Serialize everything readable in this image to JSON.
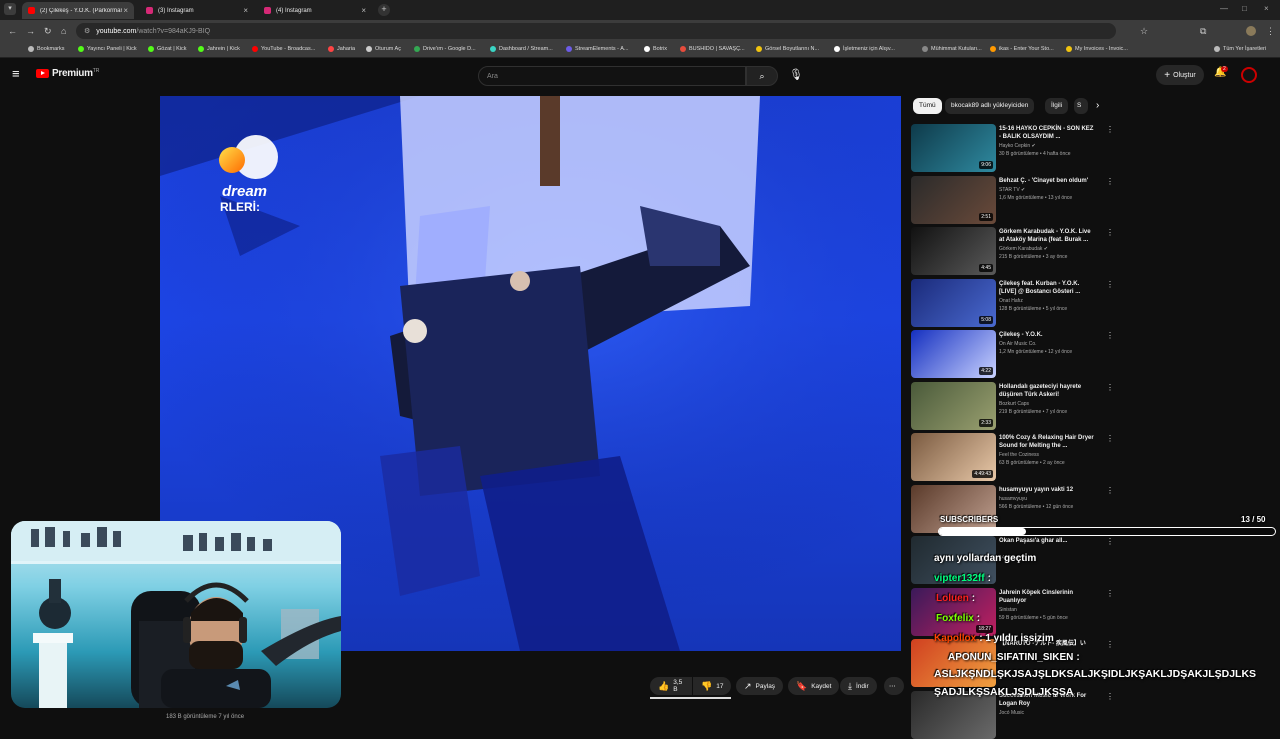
{
  "tabs": [
    {
      "label": "(2) Çilekeş - Y.O.K. (Parkorman)",
      "color": "#ff0000",
      "active": true
    },
    {
      "label": "(3) Instagram",
      "color": "#d62976",
      "active": false
    },
    {
      "label": "(4) Instagram",
      "color": "#d62976",
      "active": false
    }
  ],
  "address": {
    "domain": "youtube.com",
    "path": "/watch?v=984aKJ9-BIQ"
  },
  "bookmarks": [
    {
      "label": "Bookmarks",
      "color": "#bbbbbb"
    },
    {
      "label": "Yayıncı Paneli | Kick",
      "color": "#53fc18"
    },
    {
      "label": "Gözat | Kick",
      "color": "#53fc18"
    },
    {
      "label": "Jahrein | Kick",
      "color": "#53fc18"
    },
    {
      "label": "YouTube - Broadcas...",
      "color": "#ff0000"
    },
    {
      "label": "Jaharia",
      "color": "#ff4444"
    },
    {
      "label": "Oturum Aç",
      "color": "#cccccc"
    },
    {
      "label": "Drive'ım - Google D...",
      "color": "#34a853"
    },
    {
      "label": "Dashboard / Stream...",
      "color": "#3ad4c4"
    },
    {
      "label": "StreamElements - A...",
      "color": "#6c5ce7"
    },
    {
      "label": "Botrix",
      "color": "#ffffff"
    },
    {
      "label": "BUSHIDO | SAVAŞÇ...",
      "color": "#e74c3c"
    },
    {
      "label": "Görsel Boyutlarını N...",
      "color": "#f1c40f"
    },
    {
      "label": "İşletmeniz için Alışv...",
      "color": "#ffffff"
    },
    {
      "label": "Mühimmat Kutuları...",
      "color": "#888888"
    },
    {
      "label": "ikas - Enter Your Sto...",
      "color": "#ff9900"
    },
    {
      "label": "My Invoices - Invoic...",
      "color": "#f1c40f"
    },
    {
      "label": "Tüm Yer İşaretleri",
      "color": "#bbbbbb"
    }
  ],
  "header": {
    "logo": "Premium",
    "logo_sup": "TR",
    "search_placeholder": "Ara",
    "create_label": "Oluştur",
    "notif_count": "2"
  },
  "video": {
    "channel_logo": "dream",
    "logo_subtext": "RLERİ:"
  },
  "chips": [
    {
      "label": "Tümü",
      "selected": true
    },
    {
      "label": "bkocak89 adlı yükleyiciden",
      "selected": false
    },
    {
      "label": "İlgili",
      "selected": false
    },
    {
      "label": "S",
      "selected": false
    }
  ],
  "recommendations": [
    {
      "title": "15-16 HAYKO CEPKİN - SON KEZ - BALIK OLSAYDIM ...",
      "channel": "Hayko Cepkin ✔",
      "meta": "30 B görüntüleme • 4 hafta önce",
      "duration": "9:06",
      "c1": "#0e3a4a",
      "c2": "#2f8aa0"
    },
    {
      "title": "Behzat Ç. - 'Cinayet ben oldum'",
      "channel": "STAR TV ✔",
      "meta": "1,6 Mn görüntüleme • 13 yıl önce",
      "duration": "2:51",
      "c1": "#2a2a2a",
      "c2": "#6a4a3a"
    },
    {
      "title": "Görkem Karabudak - Y.O.K. Live at Ataköy Marina (feat. Burak ...",
      "channel": "Görkem Karabudak ✔",
      "meta": "215 B görüntüleme • 3 ay önce",
      "duration": "4:45",
      "c1": "#111111",
      "c2": "#5a5a5a"
    },
    {
      "title": "Çilekeş feat. Kurban - Y.O.K. [LIVE] @ Bostancı Gösteri ...",
      "channel": "Onat Hafız",
      "meta": "128 B görüntüleme • 5 yıl önce",
      "duration": "5:08",
      "c1": "#1a2a7a",
      "c2": "#4a6ad0"
    },
    {
      "title": "Çilekeş - Y.O.K.",
      "channel": "On Air Music Co.",
      "meta": "1,2 Mn görüntüleme • 12 yıl önce",
      "duration": "4:22",
      "c1": "#1530c0",
      "c2": "#c9d2ff"
    },
    {
      "title": "Hollandalı gazeteciyi hayrete düşüren Türk Askeri!",
      "channel": "Bozkurt Caps",
      "meta": "219 B görüntüleme • 7 yıl önce",
      "duration": "2:33",
      "c1": "#4a5a3a",
      "c2": "#9aa070"
    },
    {
      "title": "100% Cozy & Relaxing Hair Dryer Sound for Melting the ...",
      "channel": "Feel the Coziness",
      "meta": "63 B görüntüleme • 2 ay önce",
      "duration": "4:49:43",
      "c1": "#7a5a40",
      "c2": "#e8c8a8"
    },
    {
      "title": "husamyuyu yayın vakti 12",
      "channel": "husamvyuyu",
      "meta": "566 B görüntüleme • 12 gün önce",
      "duration": "",
      "c1": "#5a3a2a",
      "c2": "#c0a090"
    },
    {
      "title": "Okan Paşası'a ghar all...",
      "channel": "",
      "meta": "14 yıl önce",
      "duration": "",
      "c1": "#202a30",
      "c2": "#405060"
    },
    {
      "title": "Jahrein Köpek Cinslerinin Puanlıyor",
      "channel": "Sinistan",
      "meta": "59 B görüntüleme • 5 gün önce",
      "duration": "18:27",
      "c1": "#3a1a5a",
      "c2": "#c02060"
    },
    {
      "title": "【NARUTO -ナルト- 疾風伝】い",
      "channel": "",
      "meta": "",
      "duration": "",
      "c1": "#d04020",
      "c2": "#f0a040"
    },
    {
      "title": "Succession Music to Work For Logan Roy",
      "channel": "Jocó Music",
      "meta": "",
      "duration": "",
      "c1": "#2a2a2a",
      "c2": "#6a6a6a"
    }
  ],
  "actions": {
    "like": "3,5 B",
    "dislike": "17",
    "share": "Paylaş",
    "save": "Kaydet",
    "download": "İndir"
  },
  "below_video": "183 B görüntüleme  7 yıl önce",
  "overlay": {
    "subs_label": "SUBSCRIBERS",
    "subs_count": "13 / 50",
    "subs_fraction": 0.26,
    "messages": [
      {
        "user": "",
        "text": "aynı yollardan geçtim",
        "color": "#ffffff"
      },
      {
        "user": "vipter132ff",
        "text": ":",
        "color": "#00ff7f"
      },
      {
        "user": "Loluen",
        "text": ":",
        "color": "#ff2020"
      },
      {
        "user": "Foxfelix",
        "text": ":",
        "color": "#7cff00"
      },
      {
        "user": "Kapollox",
        "text": ": 1 yıldır işsizim",
        "color": "#ff4500"
      },
      {
        "user": "APONUN_SIFATINI_SIKEN",
        "text": ":",
        "color": "#ffffff"
      },
      {
        "user": "",
        "text": "ASLJKŞNDLŞKJSAJŞLDKSALJKŞIDLJKŞAKLJDŞAKJLŞDJLKS",
        "color": "#ffffff"
      },
      {
        "user": "",
        "text": "ŞADJLKŞSAKLJŞDLJKŞSA",
        "color": "#ffffff"
      }
    ]
  }
}
